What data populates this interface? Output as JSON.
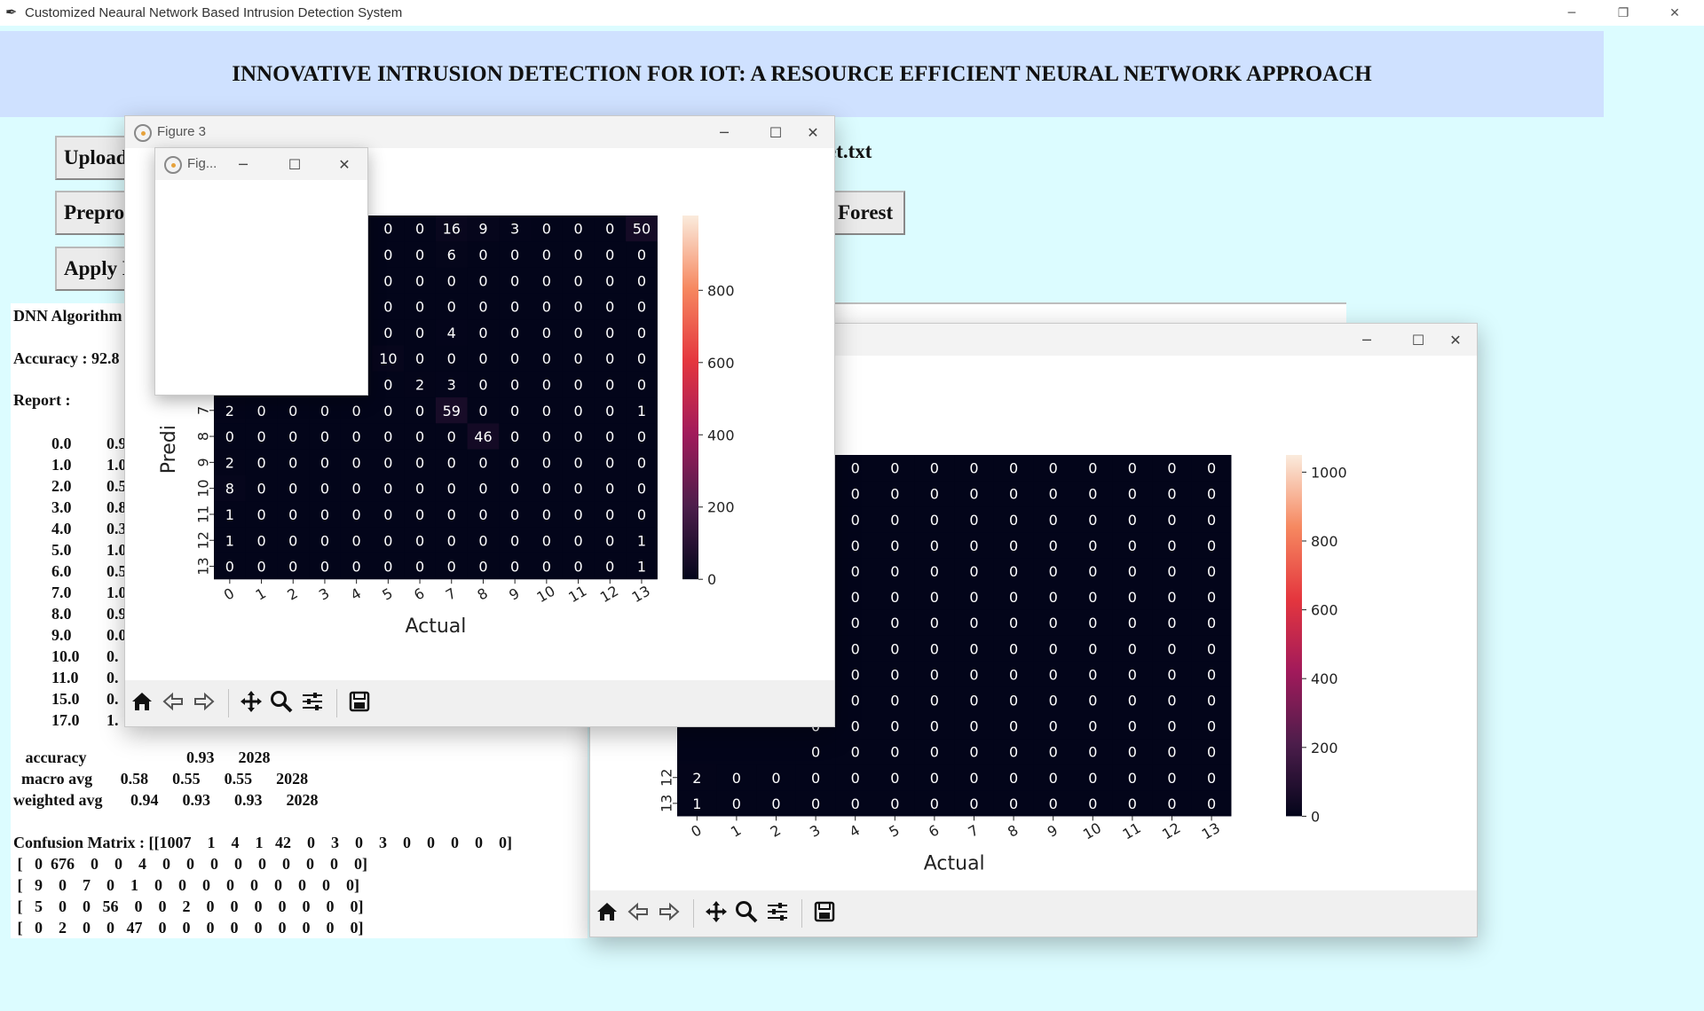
{
  "window": {
    "title": "Customized Neaural Network Based Intrusion Detection System",
    "icon": "feather-icon",
    "minimize": "─",
    "maximize": "❐",
    "close": "✕"
  },
  "heading": "INNOVATIVE INTRUSION DETECTION FOR IOT: A RESOURCE EFFICIENT NEURAL NETWORK APPROACH",
  "buttons": {
    "upload": "Upload",
    "preprocess": "Preprocess",
    "apply": "Apply DNN",
    "forest": "Forest"
  },
  "dataset_label": "et.txt",
  "output": {
    "algorithm": "DNN Algorithm",
    "accuracy": "Accuracy : 92.8",
    "report_label": "Report :",
    "report_rows": [
      {
        "label": "0.0",
        "val": "0.9"
      },
      {
        "label": "1.0",
        "val": "1.0"
      },
      {
        "label": "2.0",
        "val": "0.5"
      },
      {
        "label": "3.0",
        "val": "0.8"
      },
      {
        "label": "4.0",
        "val": "0.3"
      },
      {
        "label": "5.0",
        "val": "1.0"
      },
      {
        "label": "6.0",
        "val": "0.5"
      },
      {
        "label": "7.0",
        "val": "1.0"
      },
      {
        "label": "8.0",
        "val": "0.9"
      },
      {
        "label": "9.0",
        "val": "0.0"
      },
      {
        "label": "10.0",
        "val": "0."
      },
      {
        "label": "11.0",
        "val": "0."
      },
      {
        "label": "15.0",
        "val": "0."
      },
      {
        "label": "17.0",
        "val": "1."
      }
    ],
    "accuracy_row": "   accuracy                         0.93      2028",
    "macro_row": "  macro avg       0.58      0.55      0.55      2028",
    "weighted_row": "weighted avg       0.94      0.93      0.93      2028",
    "confusion_lines": [
      "Confusion Matrix : [[1007    1    4    1   42    0    3    0    3    0    0    0    0    0]",
      " [   0  676    0    0    4    0    0    0    0    0    0    0    0    0]",
      " [   9    0    7    0    1    0    0    0    0    0    0    0    0    0]",
      " [   5    0    0   56    0    0    2    0    0    0    0    0    0    0]",
      " [   0    2    0    0   47    0    0    0    0    0    0    0    0    0]"
    ]
  },
  "figure3": {
    "title": "Figure 3",
    "icon": "matplotlib-icon"
  },
  "figure_small": {
    "title": "Fig...",
    "icon": "matplotlib-icon"
  },
  "toolbar": [
    "home-icon",
    "back-arrow-icon",
    "forward-arrow-icon",
    "pan-icon",
    "zoom-icon",
    "configure-icon",
    "save-icon"
  ],
  "chart_data": [
    {
      "type": "heatmap",
      "xlabel": "Actual",
      "ylabel": "Predi",
      "x_ticks": [
        "0",
        "1",
        "2",
        "3",
        "4",
        "5",
        "6",
        "7",
        "8",
        "9",
        "10",
        "11",
        "12",
        "13"
      ],
      "y_ticks": [
        "7",
        "8",
        "9",
        "10",
        "11",
        "12",
        "13"
      ],
      "colorbar_ticks": [
        "800",
        "600",
        "400",
        "200",
        "0"
      ],
      "colorbar_range": [
        0,
        1007
      ],
      "visible_cells_partial_rows": [
        [
          "0",
          "0",
          "16",
          "9",
          "3",
          "0",
          "0",
          "0",
          "50"
        ],
        [
          "0",
          "0",
          "6",
          "0",
          "0",
          "0",
          "0",
          "0",
          "0"
        ],
        [
          "0",
          "0",
          "0",
          "0",
          "0",
          "0",
          "0",
          "0",
          "0"
        ],
        [
          "0",
          "0",
          "0",
          "0",
          "0",
          "0",
          "0",
          "0",
          "0"
        ],
        [
          "0",
          "0",
          "4",
          "0",
          "0",
          "0",
          "0",
          "0",
          "0"
        ],
        [
          "10",
          "0",
          "0",
          "0",
          "0",
          "0",
          "0",
          "0",
          "0"
        ],
        [
          "0",
          "2",
          "3",
          "0",
          "0",
          "0",
          "0",
          "0",
          "0"
        ]
      ],
      "visible_cells_full_rows": [
        [
          "2",
          "0",
          "0",
          "0",
          "0",
          "0",
          "0",
          "59",
          "0",
          "0",
          "0",
          "0",
          "0",
          "1"
        ],
        [
          "0",
          "0",
          "0",
          "0",
          "0",
          "0",
          "0",
          "0",
          "46",
          "0",
          "0",
          "0",
          "0",
          "0"
        ],
        [
          "2",
          "0",
          "0",
          "0",
          "0",
          "0",
          "0",
          "0",
          "0",
          "0",
          "0",
          "0",
          "0",
          "0"
        ],
        [
          "8",
          "0",
          "0",
          "0",
          "0",
          "0",
          "0",
          "0",
          "0",
          "0",
          "0",
          "0",
          "0",
          "0"
        ],
        [
          "1",
          "0",
          "0",
          "0",
          "0",
          "0",
          "0",
          "0",
          "0",
          "0",
          "0",
          "0",
          "0",
          "0"
        ],
        [
          "1",
          "0",
          "0",
          "0",
          "0",
          "0",
          "0",
          "0",
          "0",
          "0",
          "0",
          "0",
          "0",
          "1"
        ],
        [
          "0",
          "0",
          "0",
          "0",
          "0",
          "0",
          "0",
          "0",
          "0",
          "0",
          "0",
          "0",
          "0",
          "1"
        ]
      ]
    },
    {
      "type": "heatmap",
      "xlabel": "Actual",
      "x_ticks": [
        "0",
        "1",
        "2",
        "3",
        "4",
        "5",
        "6",
        "7",
        "8",
        "9",
        "10",
        "11",
        "12",
        "13"
      ],
      "y_ticks": [
        "12",
        "13"
      ],
      "colorbar_ticks": [
        "1000",
        "800",
        "600",
        "400",
        "200",
        "0"
      ],
      "colorbar_range": [
        0,
        1050
      ],
      "visible_cells_partial_rows": [
        [
          "0",
          "0",
          "0",
          "0",
          "0",
          "0",
          "0",
          "0",
          "0",
          "0",
          "0"
        ],
        [
          "0",
          "0",
          "0",
          "0",
          "0",
          "0",
          "0",
          "0",
          "0",
          "0",
          "0"
        ],
        [
          "0",
          "0",
          "0",
          "0",
          "0",
          "0",
          "0",
          "0",
          "0",
          "0",
          "0"
        ],
        [
          "0",
          "0",
          "0",
          "0",
          "0",
          "0",
          "0",
          "0",
          "0",
          "0",
          "0"
        ],
        [
          "0",
          "0",
          "0",
          "0",
          "0",
          "0",
          "0",
          "0",
          "0",
          "0",
          "0"
        ],
        [
          "0",
          "0",
          "0",
          "0",
          "0",
          "0",
          "0",
          "0",
          "0",
          "0",
          "0"
        ],
        [
          "0",
          "0",
          "0",
          "0",
          "0",
          "0",
          "0",
          "0",
          "0",
          "0",
          "0"
        ],
        [
          "0",
          "0",
          "0",
          "0",
          "0",
          "0",
          "0",
          "0",
          "0",
          "0",
          "0"
        ],
        [
          "0",
          "0",
          "0",
          "0",
          "0",
          "0",
          "0",
          "0",
          "0",
          "0",
          "0"
        ],
        [
          "0",
          "0",
          "0",
          "0",
          "0",
          "0",
          "0",
          "0",
          "0",
          "0",
          "0"
        ],
        [
          "0",
          "0",
          "0",
          "0",
          "0",
          "0",
          "0",
          "0",
          "0",
          "0",
          "0"
        ],
        [
          "0",
          "0",
          "0",
          "0",
          "0",
          "0",
          "0",
          "0",
          "0",
          "0",
          "0"
        ]
      ],
      "visible_cells_full_rows": [
        [
          "2",
          "0",
          "0",
          "0",
          "0",
          "0",
          "0",
          "0",
          "0",
          "0",
          "0",
          "0",
          "0",
          "0"
        ],
        [
          "1",
          "0",
          "0",
          "0",
          "0",
          "0",
          "0",
          "0",
          "0",
          "0",
          "0",
          "0",
          "0",
          "0"
        ]
      ]
    }
  ]
}
